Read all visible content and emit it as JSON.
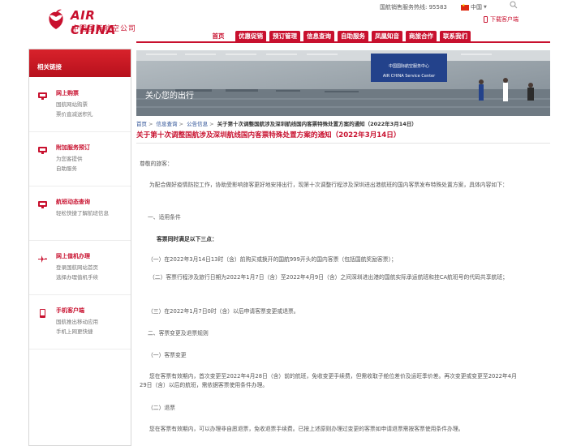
{
  "header": {
    "brand_en": "AIR CHINA",
    "brand_cn": "中国国际航空公司",
    "hotline": "国航销售服务热线: 95583",
    "language": "中国",
    "download": "下载客户端",
    "brand_color": "#c8102e"
  },
  "nav": {
    "items": [
      "首页",
      "优惠促销",
      "预订管理",
      "信息查询",
      "自助服务",
      "凤凰知音",
      "商旅合作",
      "联系我们"
    ]
  },
  "sidebar": {
    "title": "相关链接",
    "items": [
      {
        "title": "网上购票",
        "lines": [
          "国航网站购票",
          "票价直减送积礼"
        ],
        "icon": "monitor-icon"
      },
      {
        "title": "附加服务预订",
        "lines": [
          "为您客提供",
          "自助服务"
        ],
        "icon": "monitor-icon"
      },
      {
        "title": "航班动态查询",
        "lines": [
          "轻松快捷了解航班信息"
        ],
        "icon": "monitor-icon"
      },
      {
        "title": "网上值机办理",
        "lines": [
          "登录国航网站首页",
          "选择办理值机手续"
        ],
        "icon": "plane-icon"
      },
      {
        "title": "手机客户端",
        "lines": [
          "国航推出移动应用",
          "手机上网更快捷"
        ],
        "icon": "mobile-icon"
      }
    ]
  },
  "hero": {
    "slogan": "关心您的出行",
    "sign_cn": "中国国际航空服务中心",
    "sign_en": "AIR CHINA Service Center"
  },
  "breadcrumb": {
    "items": [
      "首页",
      "信息查询",
      "公告信息"
    ],
    "current": "关于第十次调整国航涉及深圳航线国内客票特殊处置方案的通知（2022年3月14日）"
  },
  "article": {
    "title": "关于第十次调整国航涉及深圳航线国内客票特殊处置方案的通知（2022年3月14日）",
    "paragraphs": [
      {
        "text": "尊敬的旅客：",
        "bold": false
      },
      {
        "text": "为配合做好疫情防控工作，协助受影响旅客更好地安排出行，现第十次调整行程涉及深圳进出港航班的国内客票发布特殊处置方案，具体内容如下：",
        "bold": false
      },
      {
        "text": "一、适用条件",
        "bold": false
      },
      {
        "text": "客票同时满足以下三点：",
        "bold": true
      },
      {
        "text": "（一）在2022年3月14日13时（含）前购买或换开的国航999开头的国内客票（包括国航奖励客票）；",
        "bold": false
      },
      {
        "text": "（二）客票行程涉及旅行日期为2022年1月7日（含）至2022年4月9日（含）之间深圳进出港的国航实际承运航班和挂CA航班号的代码共享航班；",
        "bold": false
      },
      {
        "text": "（三）在2022年1月7日0时（含）以后申请客票变更或退票。",
        "bold": false
      },
      {
        "text": "二、客票变更及退票规则",
        "bold": false
      },
      {
        "text": "（一）客票变更",
        "bold": false
      },
      {
        "text": "您在客票有效期内，首次变更至2022年4月28日（含）前的航班，免收变更手续费，但需收取子舱位差价及运旺季价差。再次变更或变更至2022年4月29日（含）以后的航班，需依据客票使用条件办理。",
        "bold": false
      },
      {
        "text": "（二）退票",
        "bold": false
      },
      {
        "text": "您在客票有效期内，可以办理非自愿退票，免收退票手续费。已按上述原则办理过变更的客票如申请退票需按客票使用条件办理。",
        "bold": false
      }
    ]
  }
}
